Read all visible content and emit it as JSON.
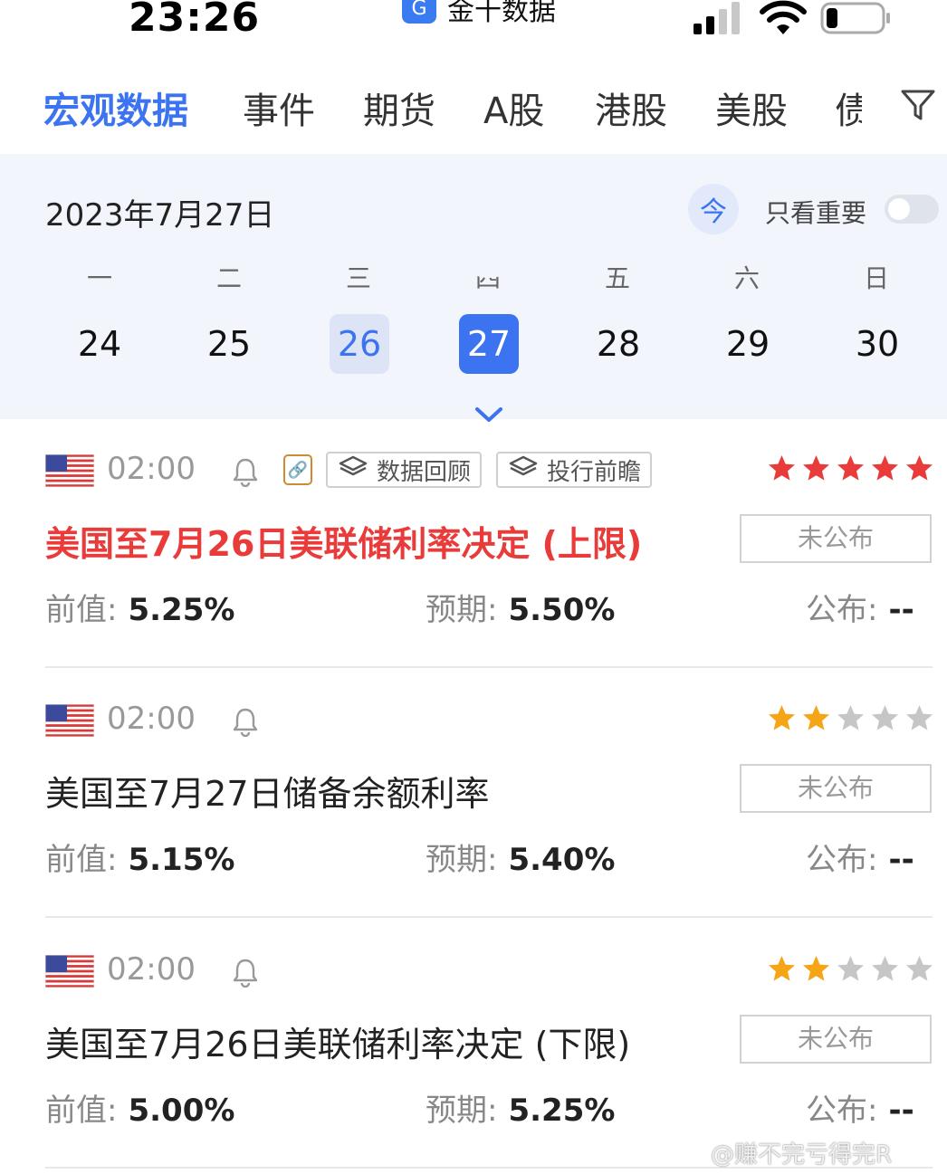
{
  "status_bar": {
    "time": "23:26",
    "app_icon_glyph": "G",
    "app_name": "金十数据",
    "battery_level": 0.2
  },
  "tabs": [
    {
      "label": "宏观数据",
      "active": true
    },
    {
      "label": "事件",
      "active": false
    },
    {
      "label": "期货",
      "active": false
    },
    {
      "label": "A股",
      "active": false
    },
    {
      "label": "港股",
      "active": false
    },
    {
      "label": "美股",
      "active": false
    },
    {
      "label": "债",
      "active": false
    }
  ],
  "filter_icon": "filter-funnel-icon",
  "calendar": {
    "current_date": "2023年7月27日",
    "today_button": "今",
    "important_only_label": "只看重要",
    "important_only_on": false,
    "weekdays": [
      "一",
      "二",
      "三",
      "四",
      "五",
      "六",
      "日"
    ],
    "days": [
      "24",
      "25",
      "26",
      "27",
      "28",
      "29",
      "30"
    ],
    "selected_day": "27",
    "yesterday_day": "26"
  },
  "events": [
    {
      "country_flag": "us-flag-icon",
      "time": "02:00",
      "has_link": true,
      "tags": [
        "数据回顾",
        "投行前瞻"
      ],
      "stars": 5,
      "star_color": "#ea3b3b",
      "title": "美国至7月26日美联储利率决定 (上限)",
      "important": true,
      "status": "未公布",
      "previous_label": "前值:",
      "previous": "5.25%",
      "forecast_label": "预期:",
      "forecast": "5.50%",
      "actual_label": "公布:",
      "actual": "--"
    },
    {
      "country_flag": "us-flag-icon",
      "time": "02:00",
      "has_link": false,
      "tags": [],
      "stars": 2,
      "star_color": "#f5a516",
      "title": "美国至7月27日储备余额利率",
      "important": false,
      "status": "未公布",
      "previous_label": "前值:",
      "previous": "5.15%",
      "forecast_label": "预期:",
      "forecast": "5.40%",
      "actual_label": "公布:",
      "actual": "--"
    },
    {
      "country_flag": "us-flag-icon",
      "time": "02:00",
      "has_link": false,
      "tags": [],
      "stars": 2,
      "star_color": "#f5a516",
      "title": "美国至7月26日美联储利率决定 (下限)",
      "important": false,
      "status": "未公布",
      "previous_label": "前值:",
      "previous": "5.00%",
      "forecast_label": "预期:",
      "forecast": "5.25%",
      "actual_label": "公布:",
      "actual": "--"
    }
  ],
  "watermark": "@赚不完亏得完R"
}
